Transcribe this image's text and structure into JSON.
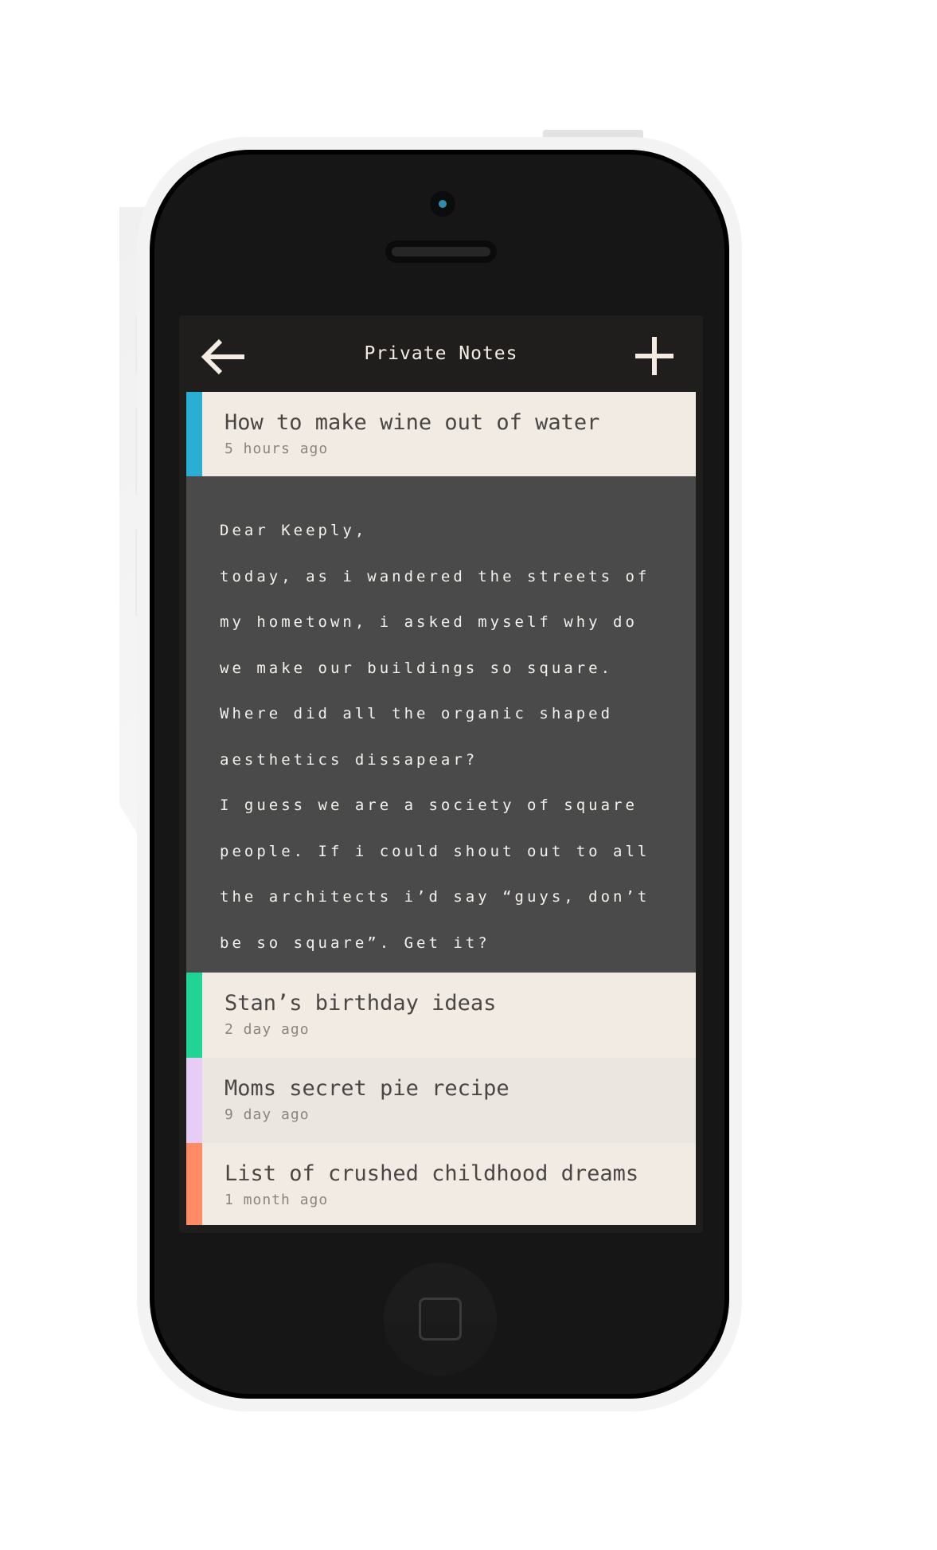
{
  "nav": {
    "title": "Private Notes",
    "back_icon": "arrow-left-icon",
    "add_icon": "plus-icon"
  },
  "colors": {
    "screen_bg": "#1f1e1d",
    "row_bg": "#f2ebe4",
    "expanded_bg": "#4a4a4a",
    "icon": "#f4ece3"
  },
  "notes": [
    {
      "title": "How to make wine out of water",
      "time": "5 hours ago",
      "color": "#2aaed3"
    },
    {
      "title": "Stan’s birthday ideas",
      "time": "2 day ago",
      "color": "#1fd494"
    },
    {
      "title": "Moms secret pie recipe",
      "time": "9 day ago",
      "color": "#e7ccf6"
    },
    {
      "title": "List of crushed childhood dreams",
      "time": "1 month ago",
      "color": "#ff8a66"
    }
  ],
  "expanded_note": {
    "lines": [
      "Dear Keeply,",
      "today, as i wandered the streets of",
      "my hometown, i asked myself why do",
      "we make our buildings so square.",
      "Where did all the organic shaped",
      "aesthetics dissapear?",
      "I guess we are a society of square",
      "people. If i could shout out to all",
      "the architects i’d say “guys, don’t",
      "be so square”. Get it?"
    ]
  }
}
